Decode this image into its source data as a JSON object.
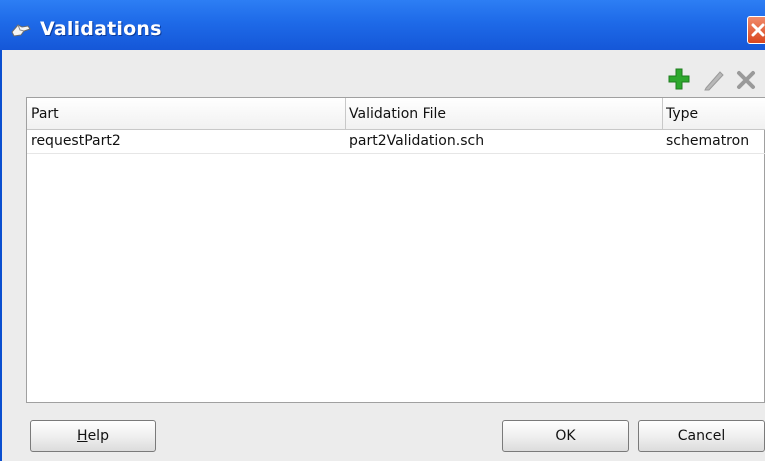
{
  "window": {
    "title": "Validations",
    "icon": "app-hand-icon",
    "close_icon": "close-icon"
  },
  "toolbar": {
    "add_icon": "add-icon",
    "edit_icon": "edit-icon",
    "delete_icon": "delete-icon"
  },
  "table": {
    "columns": [
      "Part",
      "Validation File",
      "Type"
    ],
    "rows": [
      [
        "requestPart2",
        "part2Validation.sch",
        "schematron"
      ]
    ]
  },
  "buttons": {
    "help_mnemonic": "H",
    "help_rest": "elp",
    "ok": "OK",
    "cancel": "Cancel"
  },
  "colors": {
    "titlebar": "#1e6ae8",
    "add": "#2ea82e",
    "close": "#d9461e"
  }
}
